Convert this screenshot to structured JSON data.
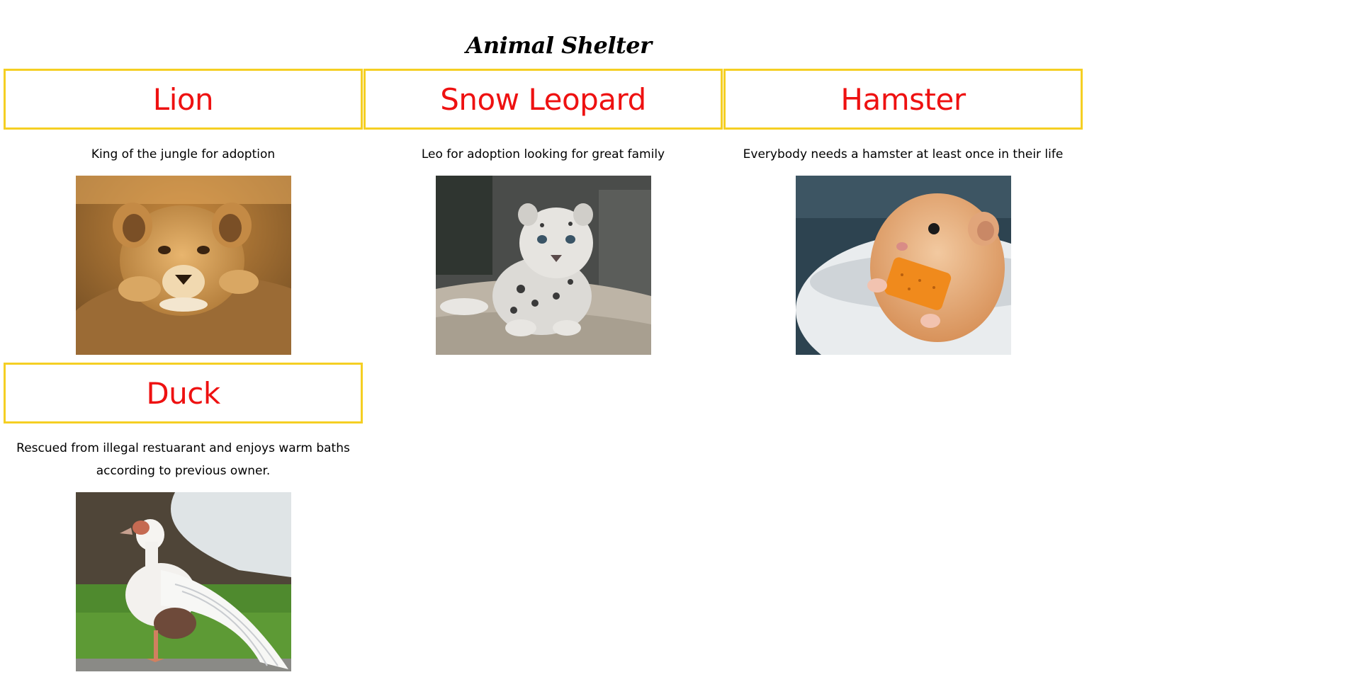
{
  "page": {
    "title": "Animal Shelter"
  },
  "animals": [
    {
      "name": "Lion",
      "description": "King of the jungle for adoption",
      "image_icon": "lion-cub-photo"
    },
    {
      "name": "Snow Leopard",
      "description": "Leo for adoption looking for great family",
      "image_icon": "snow-leopard-cub-photo"
    },
    {
      "name": "Hamster",
      "description": "Everybody needs a hamster at least once in their life",
      "image_icon": "hamster-photo"
    },
    {
      "name": "Duck",
      "description": "Rescued from illegal restuarant and enjoys warm baths according to previous owner.",
      "image_icon": "duck-photo"
    }
  ],
  "colors": {
    "header_border": "#f5cf23",
    "name_text": "#ee1111",
    "body_text": "#000000",
    "background": "#ffffff"
  }
}
